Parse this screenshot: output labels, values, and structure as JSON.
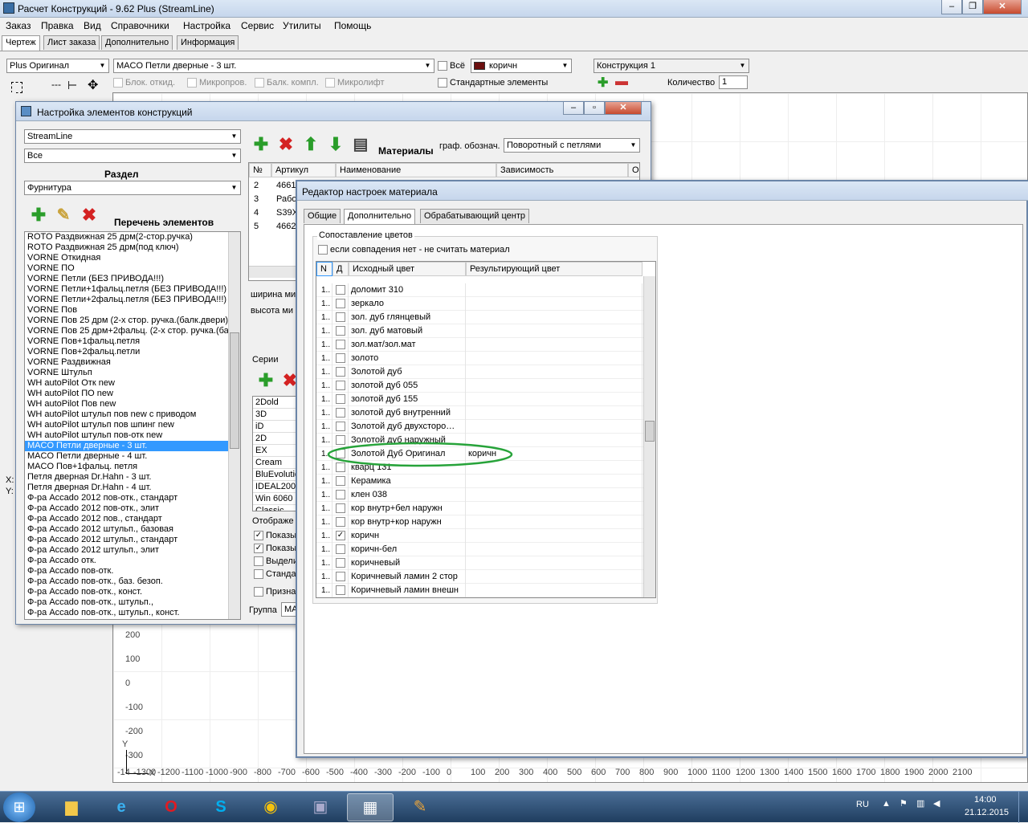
{
  "app": {
    "title": "Расчет Конструкций - 9.62 Plus (StreamLine)",
    "menu": [
      "Заказ",
      "Правка",
      "Вид",
      "Справочники",
      "Настройка",
      "Сервис",
      "Утилиты",
      "Помощь"
    ],
    "tabs": [
      "Чертеж",
      "Лист заказа",
      "Дополнительно",
      "Информация"
    ],
    "toolbar": {
      "profile": "Plus Оригинал",
      "element": "MACO Петли дверные - 3 шт.",
      "all_label": "Всё",
      "color": "коричн",
      "color_swatch": "#6b0f0f",
      "construction": "Конструкция 1",
      "opts": [
        "Блок. откид.",
        "Микропров.",
        "Балк. компл.",
        "Микролифт"
      ],
      "standard_label": "Стандартные элементы",
      "qty_label": "Количество",
      "qty_value": "1"
    },
    "axis_x": [
      "-1300",
      "-1200",
      "-1100",
      "-1000",
      "-900",
      "-800",
      "-700",
      "-600",
      "-500",
      "-400",
      "-300",
      "-200",
      "-100",
      "0",
      "100",
      "200",
      "300",
      "400",
      "500",
      "600",
      "700",
      "800",
      "900",
      "1000",
      "1100",
      "1200",
      "1300",
      "1400",
      "1500",
      "1600",
      "1700",
      "1800",
      "1900",
      "2000",
      "2100"
    ],
    "axis_x_prefix": "-14",
    "axis_y": [
      "200",
      "100",
      "0",
      "-100",
      "-200",
      "-300"
    ],
    "axis_y_label": "Y",
    "axis_x_label": "X",
    "side_labels": [
      "X:",
      "Y:"
    ]
  },
  "dialog1": {
    "title": "Настройка элементов конструкций",
    "system": "StreamLine",
    "filter": "Все",
    "section_label": "Раздел",
    "section": "Фурнитура",
    "list_label": "Перечень элементов",
    "items": [
      "ROTO Раздвижная 25 дрм(2-стор.ручка)",
      "ROTO Раздвижная 25 дрм(под ключ)",
      "VORNE Откидная",
      "VORNE ПО",
      "VORNE Петли  (БЕЗ ПРИВОДА!!!)",
      "VORNE Петли+1фальц.петля  (БЕЗ ПРИВОДА!!!)",
      "VORNE Петли+2фальц.петля  (БЕЗ ПРИВОДА!!!)",
      "VORNE Пов",
      "VORNE Пов 25 дрм (2-х стор. ручка.(балк.двери)",
      "VORNE Пов 25 дрм+2фальц. (2-х стор. ручка.(ба",
      "VORNE Пов+1фальц.петля",
      "VORNE Пов+2фальц.петли",
      "VORNE Раздвижная",
      "VORNE Штульп",
      "WH autoPilot Отк new",
      "WH autoPilot ПО new",
      "WH autoPilot Пов new",
      "WH autoPilot штульп пов new с приводом",
      "WH autoPilot штульп пов шпинг new",
      "WH autoPilot штульп пов-отк new",
      "MACO Петли дверные - 3 шт.",
      "MACO Петли дверные - 4 шт.",
      "MACO Пов+1фальц. петля",
      "Петля дверная Dr.Hahn - 3 шт.",
      "Петля дверная Dr.Hahn - 4 шт.",
      "Ф-ра Accado 2012 пов-отк., стандарт",
      "Ф-ра Accado 2012 пов-отк., элит",
      "Ф-ра Accado 2012 пов., стандарт",
      "Ф-ра Accado 2012 штульп., базовая",
      "Ф-ра Accado 2012 штульп., стандарт",
      "Ф-ра Accado 2012 штульп., элит",
      "Ф-ра Accado отк.",
      "Ф-ра Accado пов-отк.",
      "Ф-ра Accado пов-отк., баз. безоп.",
      "Ф-ра Accado пов-отк., конст.",
      "Ф-ра Accado пов-отк., штульп.,",
      "Ф-ра Accado пов-отк., штульп., конст."
    ],
    "selected_index": 20,
    "materials_label": "Материалы",
    "graf_label": "граф. обознач.",
    "graf_value": "Поворотный с петлями",
    "mat_headers": [
      "№",
      "Артикул",
      "Наименование",
      "Зависимость",
      "О"
    ],
    "mat_rows": [
      {
        "n": "2",
        "art": "4661"
      },
      {
        "n": "3",
        "art": "Рабо"
      },
      {
        "n": "4",
        "art": "S39X"
      },
      {
        "n": "5",
        "art": "4662"
      }
    ],
    "width_label": "ширина ми",
    "height_label": "высота ми",
    "series_label": "Серии",
    "series": [
      "2Dold",
      "3D",
      "iD",
      "2D",
      "EX",
      "Cream",
      "BluEvolutio",
      "IDEAL2000",
      "Win 6060",
      "Classic"
    ],
    "display_label": "Отображе",
    "display_opts": [
      {
        "label": "Показы",
        "checked": true
      },
      {
        "label": "Показы",
        "checked": true
      },
      {
        "label": "Выдели",
        "checked": false
      },
      {
        "label": "Станда",
        "checked": false
      }
    ],
    "sign_label": "Призна",
    "group_label": "Группа",
    "group_value": "MA"
  },
  "dialog2": {
    "title": "Редактор настроек материала",
    "tabs": [
      "Общие",
      "Дополнительно",
      "Обрабатывающий центр"
    ],
    "active_tab": 1,
    "group_label": "Сопоставление цветов",
    "no_match_label": "если совпадения нет - не считать материал",
    "headers": [
      "N",
      "Д",
      "Исходный цвет",
      "Результирующий цвет"
    ],
    "rows": [
      {
        "n": "1..",
        "checked": false,
        "src": "доломит 310",
        "dst": ""
      },
      {
        "n": "1..",
        "checked": false,
        "src": "зеркало",
        "dst": ""
      },
      {
        "n": "1..",
        "checked": false,
        "src": "зол. дуб глянцевый",
        "dst": ""
      },
      {
        "n": "1..",
        "checked": false,
        "src": "зол. дуб матовый",
        "dst": ""
      },
      {
        "n": "1..",
        "checked": false,
        "src": "зол.мат/зол.мат",
        "dst": ""
      },
      {
        "n": "1..",
        "checked": false,
        "src": "золото",
        "dst": ""
      },
      {
        "n": "1..",
        "checked": false,
        "src": "Золотой дуб",
        "dst": ""
      },
      {
        "n": "1..",
        "checked": false,
        "src": "золотой дуб 055",
        "dst": ""
      },
      {
        "n": "1..",
        "checked": false,
        "src": "золотой дуб 155",
        "dst": ""
      },
      {
        "n": "1..",
        "checked": false,
        "src": "золотой дуб внутренний",
        "dst": ""
      },
      {
        "n": "1..",
        "checked": false,
        "src": "Золотой дуб двухсторо…",
        "dst": ""
      },
      {
        "n": "1..",
        "checked": false,
        "src": "Золотой дуб наружный",
        "dst": ""
      },
      {
        "n": "1..",
        "checked": false,
        "src": "Золотой Дуб Оригинал",
        "dst": "коричн"
      },
      {
        "n": "1..",
        "checked": false,
        "src": "кварц 131",
        "dst": ""
      },
      {
        "n": "1..",
        "checked": false,
        "src": "Керамика",
        "dst": ""
      },
      {
        "n": "1..",
        "checked": false,
        "src": "клен 038",
        "dst": ""
      },
      {
        "n": "1..",
        "checked": false,
        "src": "кор внутр+бел наружн",
        "dst": ""
      },
      {
        "n": "1..",
        "checked": false,
        "src": "кор внутр+кор наружн",
        "dst": ""
      },
      {
        "n": "1..",
        "checked": true,
        "src": "коричн",
        "dst": ""
      },
      {
        "n": "1..",
        "checked": false,
        "src": "коричн-бел",
        "dst": ""
      },
      {
        "n": "1..",
        "checked": false,
        "src": "коричневый",
        "dst": ""
      },
      {
        "n": "1..",
        "checked": false,
        "src": "Коричневый ламин 2 стор",
        "dst": ""
      },
      {
        "n": "1..",
        "checked": false,
        "src": "Коричневый ламин внешн",
        "dst": ""
      }
    ]
  },
  "taskbar": {
    "lang": "RU",
    "time": "14:00",
    "date": "21.12.2015"
  }
}
